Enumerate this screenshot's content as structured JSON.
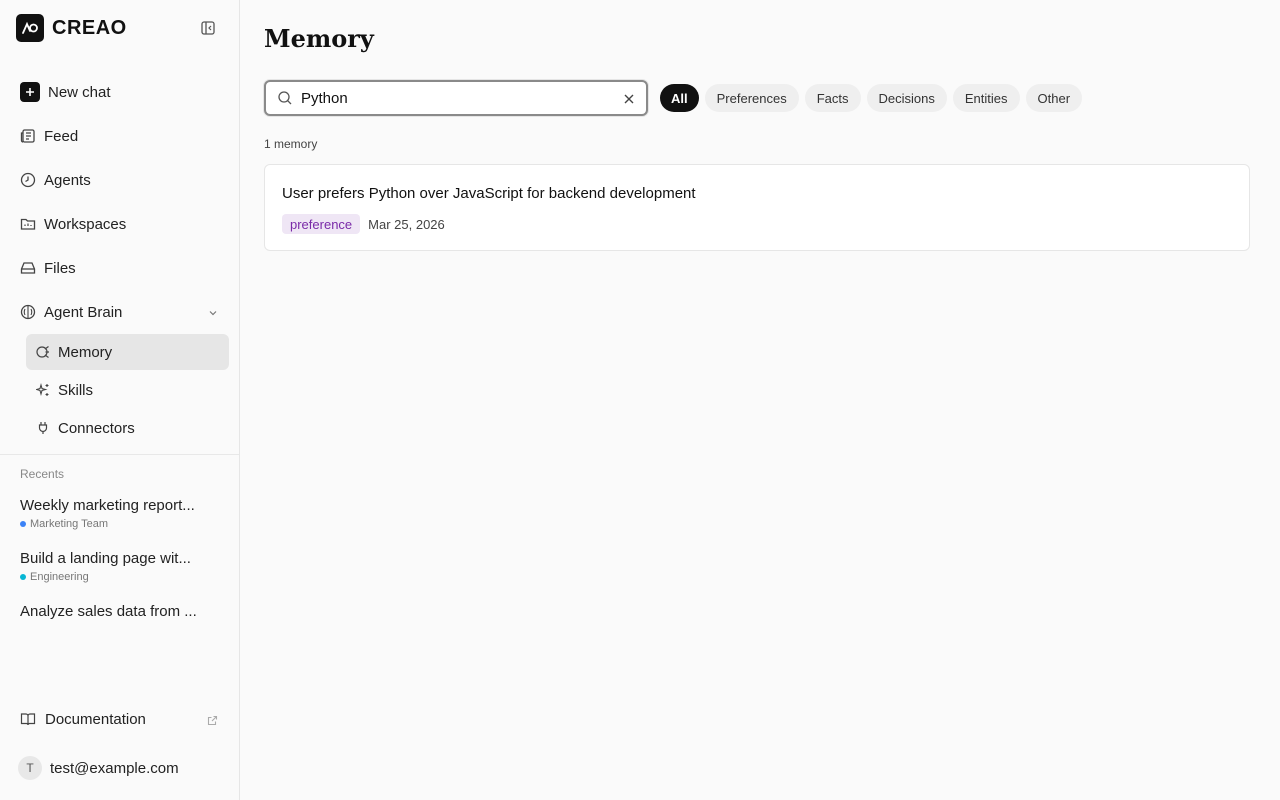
{
  "brand": {
    "name": "CREAO"
  },
  "nav": {
    "new_chat": "New chat",
    "feed": "Feed",
    "agents": "Agents",
    "workspaces": "Workspaces",
    "files": "Files",
    "agent_brain": "Agent Brain",
    "sub": {
      "memory": "Memory",
      "skills": "Skills",
      "connectors": "Connectors"
    }
  },
  "recents": {
    "label": "Recents",
    "items": [
      {
        "title": "Weekly marketing report...",
        "tag": "Marketing Team",
        "tag_color": "#3b82f6"
      },
      {
        "title": "Build a landing page wit...",
        "tag": "Engineering",
        "tag_color": "#06b6d4"
      },
      {
        "title": "Analyze sales data from ...",
        "tag": ""
      }
    ]
  },
  "footer": {
    "documentation": "Documentation",
    "user_email": "test@example.com",
    "avatar_initial": "T"
  },
  "main": {
    "title": "Memory",
    "search": {
      "value": "Python",
      "placeholder": ""
    },
    "filters": [
      "All",
      "Preferences",
      "Facts",
      "Decisions",
      "Entities",
      "Other"
    ],
    "active_filter": "All",
    "count": "1 memory",
    "memories": [
      {
        "text": "User prefers Python over JavaScript for backend development",
        "type": "preference",
        "date": "Mar 25, 2026"
      }
    ]
  },
  "colors": {
    "accent": "#111111",
    "active_nav_bg": "#e6e6e6",
    "badge_text": "#7a2aa8",
    "badge_bg": "#efe6f5"
  }
}
